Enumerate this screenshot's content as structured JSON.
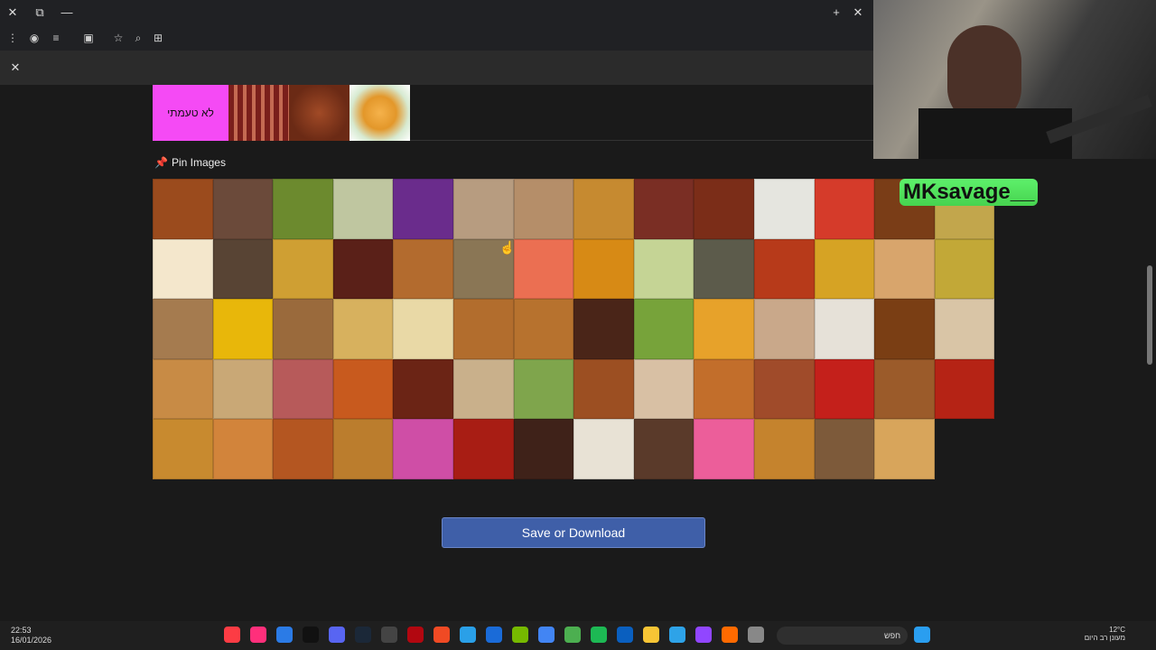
{
  "tier": {
    "label": "לא טעמתי"
  },
  "pin_section": {
    "title": "Pin Images"
  },
  "save": {
    "label": "Save or Download"
  },
  "stream": {
    "handle": "MKsavage__"
  },
  "clock": {
    "time": "22:53",
    "date": "16/01/2026"
  },
  "weather": {
    "temp": "12°C",
    "desc": "מעונן רב היום"
  },
  "search": {
    "placeholder": "חפש"
  },
  "colors": {
    "tier_label": "#f54af5",
    "save_button": "#3f5fa8",
    "background": "#1a1a1a"
  },
  "tier_images": [
    "bacon-image",
    "pie-image",
    "taco-image"
  ],
  "food_images": [
    "latkes",
    "cake-slice",
    "peas-carrots",
    "rice-veg",
    "icepop",
    "shawarma-wrap",
    "wrap",
    "spring-rolls",
    "lasagna",
    "chicken-wings",
    "rice",
    "pizza",
    "muffin",
    "kunafa",
    "fried-egg",
    "kebabs",
    "omelette",
    "steak",
    "waffles",
    "falafel-plate",
    "sushi",
    "honey",
    "salad-bowl",
    "fish",
    "meatballs",
    "corn",
    "toast",
    "soup",
    "schnitzel",
    "corn-kernels",
    "cookies",
    "pudding",
    "crackers",
    "fries",
    "pancakes",
    "brownies",
    "green-salad",
    "fruit-salad",
    "kreplach",
    "fish-dish",
    "fried-chicken",
    "pastry",
    "sausage-rolls",
    "pita",
    "trifle",
    "cheese-toast",
    "meatball-pan",
    "borek",
    "mashed",
    "fried-cutlets",
    "hummus",
    "pasta",
    "fusilli",
    "stuffed-peppers",
    "bagels",
    "tomato-soup",
    "garlic-bread",
    "rice-veg-2",
    "stuffed-veg",
    "quiche",
    "candy-bar",
    "shakshuka",
    "chocolate",
    "ice-cream",
    "liver",
    "donuts",
    "burger",
    "baked-chicken",
    "quesadilla"
  ]
}
